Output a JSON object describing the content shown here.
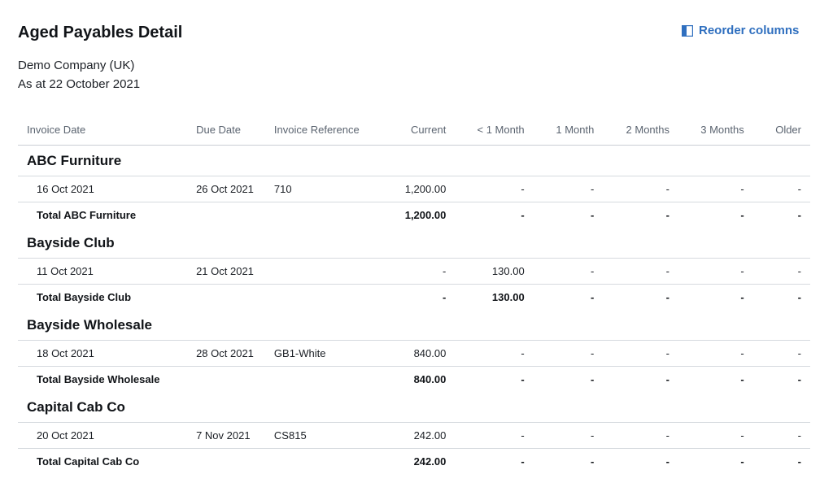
{
  "report": {
    "title": "Aged Payables Detail",
    "company": "Demo Company (UK)",
    "as_at": "As at 22 October 2021",
    "reorder_label": "Reorder columns",
    "reorder_icon": "columns-icon",
    "accent_color": "#2f6fbf"
  },
  "columns": [
    "Invoice Date",
    "Due Date",
    "Invoice Reference",
    "Current",
    "< 1 Month",
    "1 Month",
    "2 Months",
    "3 Months",
    "Older"
  ],
  "groups": [
    {
      "name": "ABC Furniture",
      "rows": [
        [
          "16 Oct 2021",
          "26 Oct 2021",
          "710",
          "1,200.00",
          "-",
          "-",
          "-",
          "-",
          "-"
        ]
      ],
      "total": [
        "Total ABC Furniture",
        "1,200.00",
        "-",
        "-",
        "-",
        "-",
        "-"
      ]
    },
    {
      "name": "Bayside Club",
      "rows": [
        [
          "11 Oct 2021",
          "21 Oct 2021",
          "",
          "-",
          "130.00",
          "-",
          "-",
          "-",
          "-"
        ]
      ],
      "total": [
        "Total Bayside Club",
        "-",
        "130.00",
        "-",
        "-",
        "-",
        "-"
      ]
    },
    {
      "name": "Bayside Wholesale",
      "rows": [
        [
          "18 Oct 2021",
          "28 Oct 2021",
          "GB1-White",
          "840.00",
          "-",
          "-",
          "-",
          "-",
          "-"
        ]
      ],
      "total": [
        "Total Bayside Wholesale",
        "840.00",
        "-",
        "-",
        "-",
        "-",
        "-"
      ]
    },
    {
      "name": "Capital Cab Co",
      "rows": [
        [
          "20 Oct 2021",
          "7 Nov 2021",
          "CS815",
          "242.00",
          "-",
          "-",
          "-",
          "-",
          "-"
        ]
      ],
      "total": [
        "Total Capital Cab Co",
        "242.00",
        "-",
        "-",
        "-",
        "-",
        "-"
      ]
    }
  ]
}
